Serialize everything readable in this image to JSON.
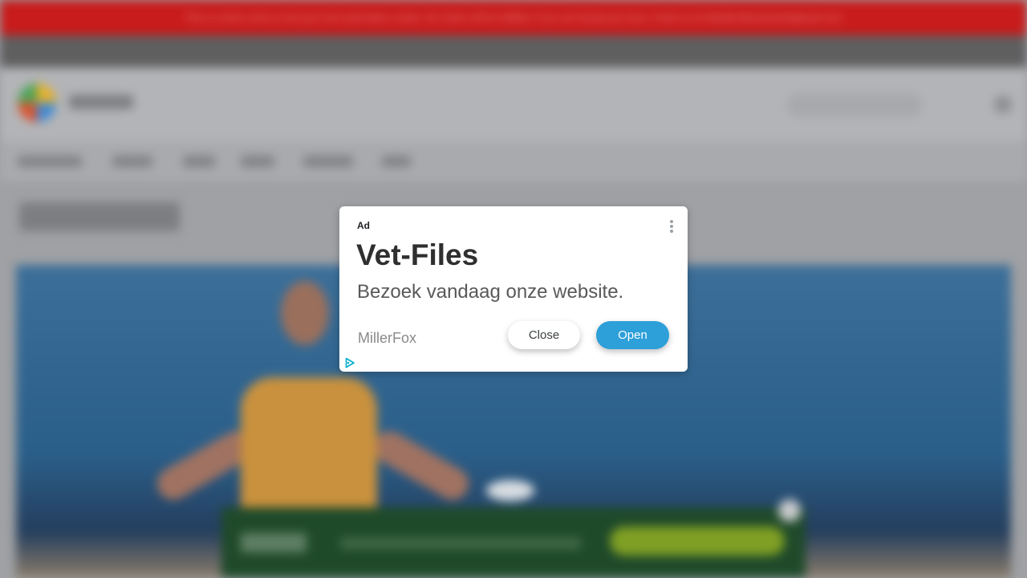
{
  "background": {
    "demo_banner_text": "This is a demo store to test your test automation scripts. No orders will be fulfilled. If you are facing any issue, email us at hello@softwaretestingboard.com"
  },
  "ad": {
    "label": "Ad",
    "headline": "Vet-Files",
    "description": "Bezoek vandaag onze website.",
    "advertiser": "MillerFox",
    "close_label": "Close",
    "open_label": "Open",
    "menu_icon": "more-vert-icon",
    "adchoices_icon": "adchoices-icon",
    "accent_color": "#2d9fd9"
  }
}
